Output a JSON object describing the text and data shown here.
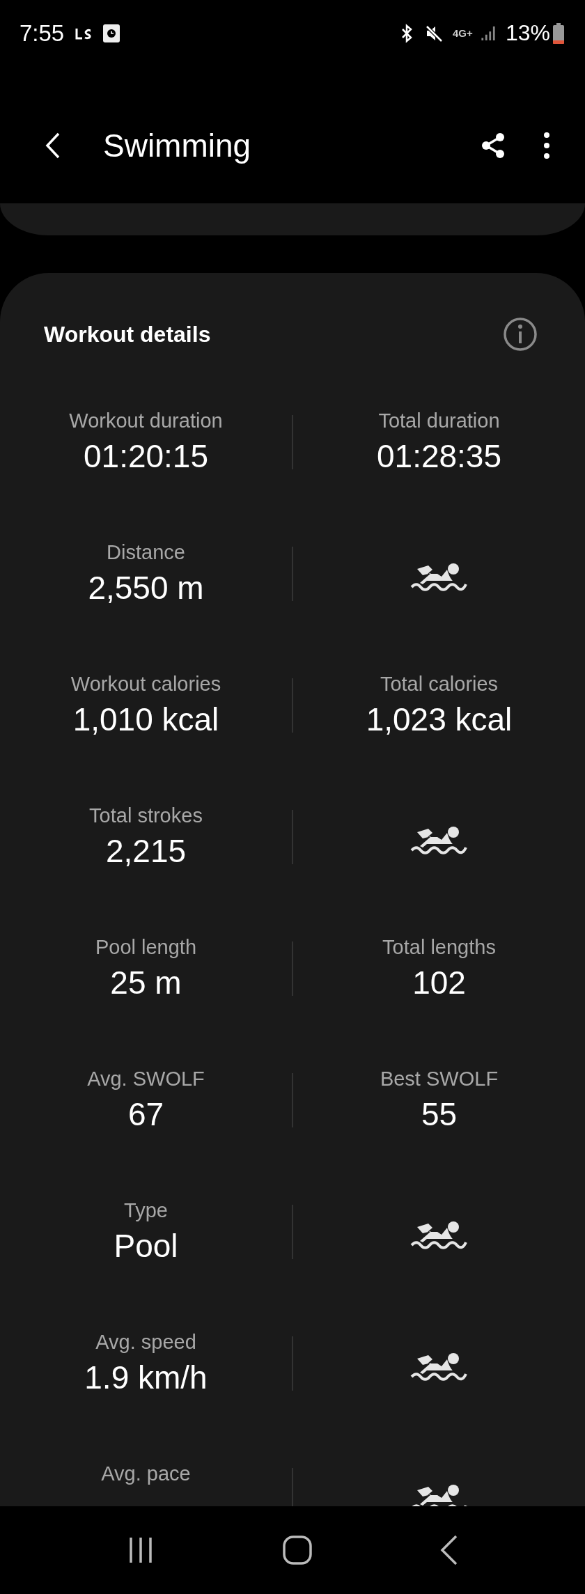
{
  "status_bar": {
    "time": "7:55",
    "network": "4G+",
    "battery": "13%"
  },
  "header": {
    "title": "Swimming"
  },
  "card": {
    "title": "Workout details",
    "rows": [
      [
        {
          "kind": "stat",
          "label": "Workout duration",
          "value": "01:20:15"
        },
        {
          "kind": "stat",
          "label": "Total duration",
          "value": "01:28:35"
        }
      ],
      [
        {
          "kind": "stat",
          "label": "Distance",
          "value": "2,550 m"
        },
        {
          "kind": "icon"
        }
      ],
      [
        {
          "kind": "stat",
          "label": "Workout calories",
          "value": "1,010 kcal"
        },
        {
          "kind": "stat",
          "label": "Total calories",
          "value": "1,023 kcal"
        }
      ],
      [
        {
          "kind": "stat",
          "label": "Total strokes",
          "value": "2,215"
        },
        {
          "kind": "icon"
        }
      ],
      [
        {
          "kind": "stat",
          "label": "Pool length",
          "value": "25 m"
        },
        {
          "kind": "stat",
          "label": "Total lengths",
          "value": "102"
        }
      ],
      [
        {
          "kind": "stat",
          "label": "Avg. SWOLF",
          "value": "67"
        },
        {
          "kind": "stat",
          "label": "Best SWOLF",
          "value": "55"
        }
      ],
      [
        {
          "kind": "stat",
          "label": "Type",
          "value": "Pool"
        },
        {
          "kind": "icon"
        }
      ],
      [
        {
          "kind": "stat",
          "label": "Avg. speed",
          "value": "1.9 km/h"
        },
        {
          "kind": "icon"
        }
      ],
      [
        {
          "kind": "stat",
          "label": "Avg. pace"
        },
        {
          "kind": "icon"
        }
      ]
    ]
  }
}
